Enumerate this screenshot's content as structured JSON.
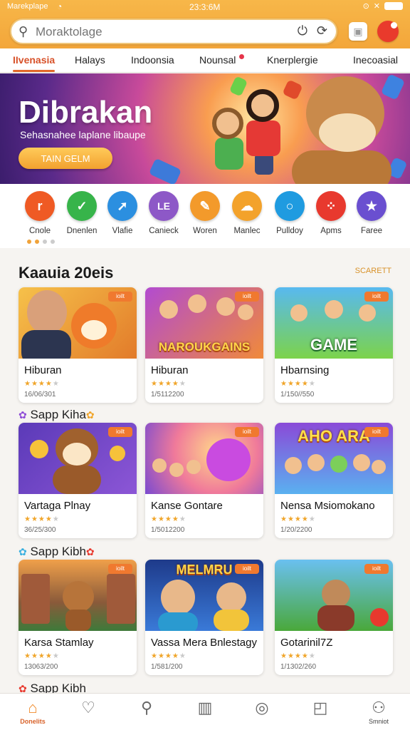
{
  "status_bar": {
    "carrier": "Marekplape",
    "time": "23:3:6M"
  },
  "search": {
    "placeholder": "Moraktolage"
  },
  "tabs": [
    "IIvenasia",
    "Halays",
    "Indoonsia",
    "Nounsal",
    "Knerplergie",
    "Inecoasial"
  ],
  "banner": {
    "title": "Dibrakan",
    "subtitle": "Sehasnahee laplane libaupe",
    "cta": "TAIN GELM"
  },
  "categories": [
    {
      "label": "Cnole",
      "color": "#ef5a24",
      "icon": "r"
    },
    {
      "label": "Dnenlen",
      "color": "#37b44a",
      "icon": "check"
    },
    {
      "label": "Vlafie",
      "color": "#2b8fe0",
      "icon": "compass"
    },
    {
      "label": "Canieck",
      "color": "#8d58c7",
      "icon": "LE"
    },
    {
      "label": "Woren",
      "color": "#f39a2b",
      "icon": "edit"
    },
    {
      "label": "Manlec",
      "color": "#f3a22b",
      "icon": "cloud"
    },
    {
      "label": "Pulldoy",
      "color": "#1f9be0",
      "icon": "ring"
    },
    {
      "label": "Apms",
      "color": "#e8392e",
      "icon": "grid"
    },
    {
      "label": "Faree",
      "color": "#6a4fd0",
      "icon": "star"
    }
  ],
  "section": {
    "title": "Kaauia 20eis",
    "link": "SCARETT"
  },
  "subheads": [
    "Sapp Kiha",
    "Sapp Kibh",
    "Sapp Kibh"
  ],
  "cards": [
    {
      "name": "Hiburan",
      "meta": "16/06/301",
      "stars": 4,
      "badge": "ioilt"
    },
    {
      "name": "Hiburan",
      "meta": "1/5112200",
      "stars": 4,
      "badge": "ioilt",
      "word": "NAROUKGAINS"
    },
    {
      "name": "Hbarnsing",
      "meta": "1/150//550",
      "stars": 4,
      "badge": "ioilt",
      "word": "GAME"
    },
    {
      "name": "Vartaga Plnay",
      "meta": "36/25/300",
      "stars": 4,
      "badge": "ioilt"
    },
    {
      "name": "Kanse Gontare",
      "meta": "1/5012200",
      "stars": 4,
      "badge": "ioilt"
    },
    {
      "name": "Nensa Msiomokano",
      "meta": "1/20/2200",
      "stars": 4,
      "badge": "ioilt",
      "word": "AHO ARA"
    },
    {
      "name": "Karsa Stamlay",
      "meta": "13063/200",
      "stars": 4,
      "badge": "ioilt"
    },
    {
      "name": "Vassa Mera Bnlestagy",
      "meta": "1/581/200",
      "stars": 4,
      "badge": "ioilt",
      "word": "MELMRU"
    },
    {
      "name": "Gotarinil7Z",
      "meta": "1/1302/260",
      "stars": 4,
      "badge": "ioilt"
    }
  ],
  "bottom_nav": [
    {
      "label": "Donelits",
      "icon": "home-icon"
    },
    {
      "label": "",
      "icon": "location-icon"
    },
    {
      "label": "",
      "icon": "pin-icon"
    },
    {
      "label": "",
      "icon": "bag-icon"
    },
    {
      "label": "",
      "icon": "search-icon"
    },
    {
      "label": "",
      "icon": "note-icon"
    },
    {
      "label": "Smniot",
      "icon": "profile-icon"
    }
  ]
}
